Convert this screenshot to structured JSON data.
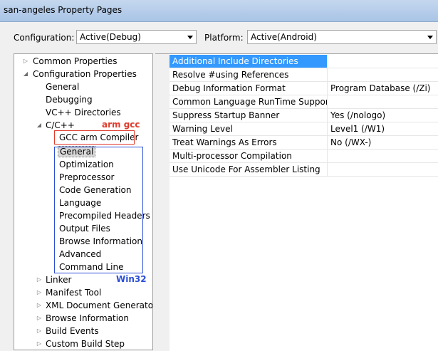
{
  "window": {
    "title": "san-angeles Property Pages"
  },
  "toolbar": {
    "configuration_label": "Configuration:",
    "configuration_value": "Active(Debug)",
    "platform_label": "Platform:",
    "platform_value": "Active(Android)"
  },
  "tree": {
    "items": [
      {
        "label": "Common Properties"
      },
      {
        "label": "Configuration Properties"
      },
      {
        "label": "General"
      },
      {
        "label": "Debugging"
      },
      {
        "label": "VC++ Directories"
      },
      {
        "label": "C/C++"
      },
      {
        "label": "GCC arm Compiler"
      },
      {
        "label": "General"
      },
      {
        "label": "Optimization"
      },
      {
        "label": "Preprocessor"
      },
      {
        "label": "Code Generation"
      },
      {
        "label": "Language"
      },
      {
        "label": "Precompiled Headers"
      },
      {
        "label": "Output Files"
      },
      {
        "label": "Browse Information"
      },
      {
        "label": "Advanced"
      },
      {
        "label": "Command Line"
      },
      {
        "label": "Linker"
      },
      {
        "label": "Manifest Tool"
      },
      {
        "label": "XML Document Generator"
      },
      {
        "label": "Browse Information"
      },
      {
        "label": "Build Events"
      },
      {
        "label": "Custom Build Step"
      }
    ],
    "annotations": {
      "arm_gcc": "arm gcc",
      "win32": "Win32",
      "red_color": "#e03b2b",
      "blue_color": "#2b4fd6"
    }
  },
  "grid": {
    "rows": [
      {
        "name": "Additional Include Directories",
        "value": ""
      },
      {
        "name": "Resolve #using References",
        "value": ""
      },
      {
        "name": "Debug Information Format",
        "value": "Program Database (/Zi)"
      },
      {
        "name": "Common Language RunTime Support",
        "value": ""
      },
      {
        "name": "Suppress Startup Banner",
        "value": "Yes (/nologo)"
      },
      {
        "name": "Warning Level",
        "value": "Level1 (/W1)"
      },
      {
        "name": "Treat Warnings As Errors",
        "value": "No (/WX-)"
      },
      {
        "name": "Multi-processor Compilation",
        "value": ""
      },
      {
        "name": "Use Unicode For Assembler Listing",
        "value": ""
      }
    ],
    "selected_color": "#3399ff"
  }
}
